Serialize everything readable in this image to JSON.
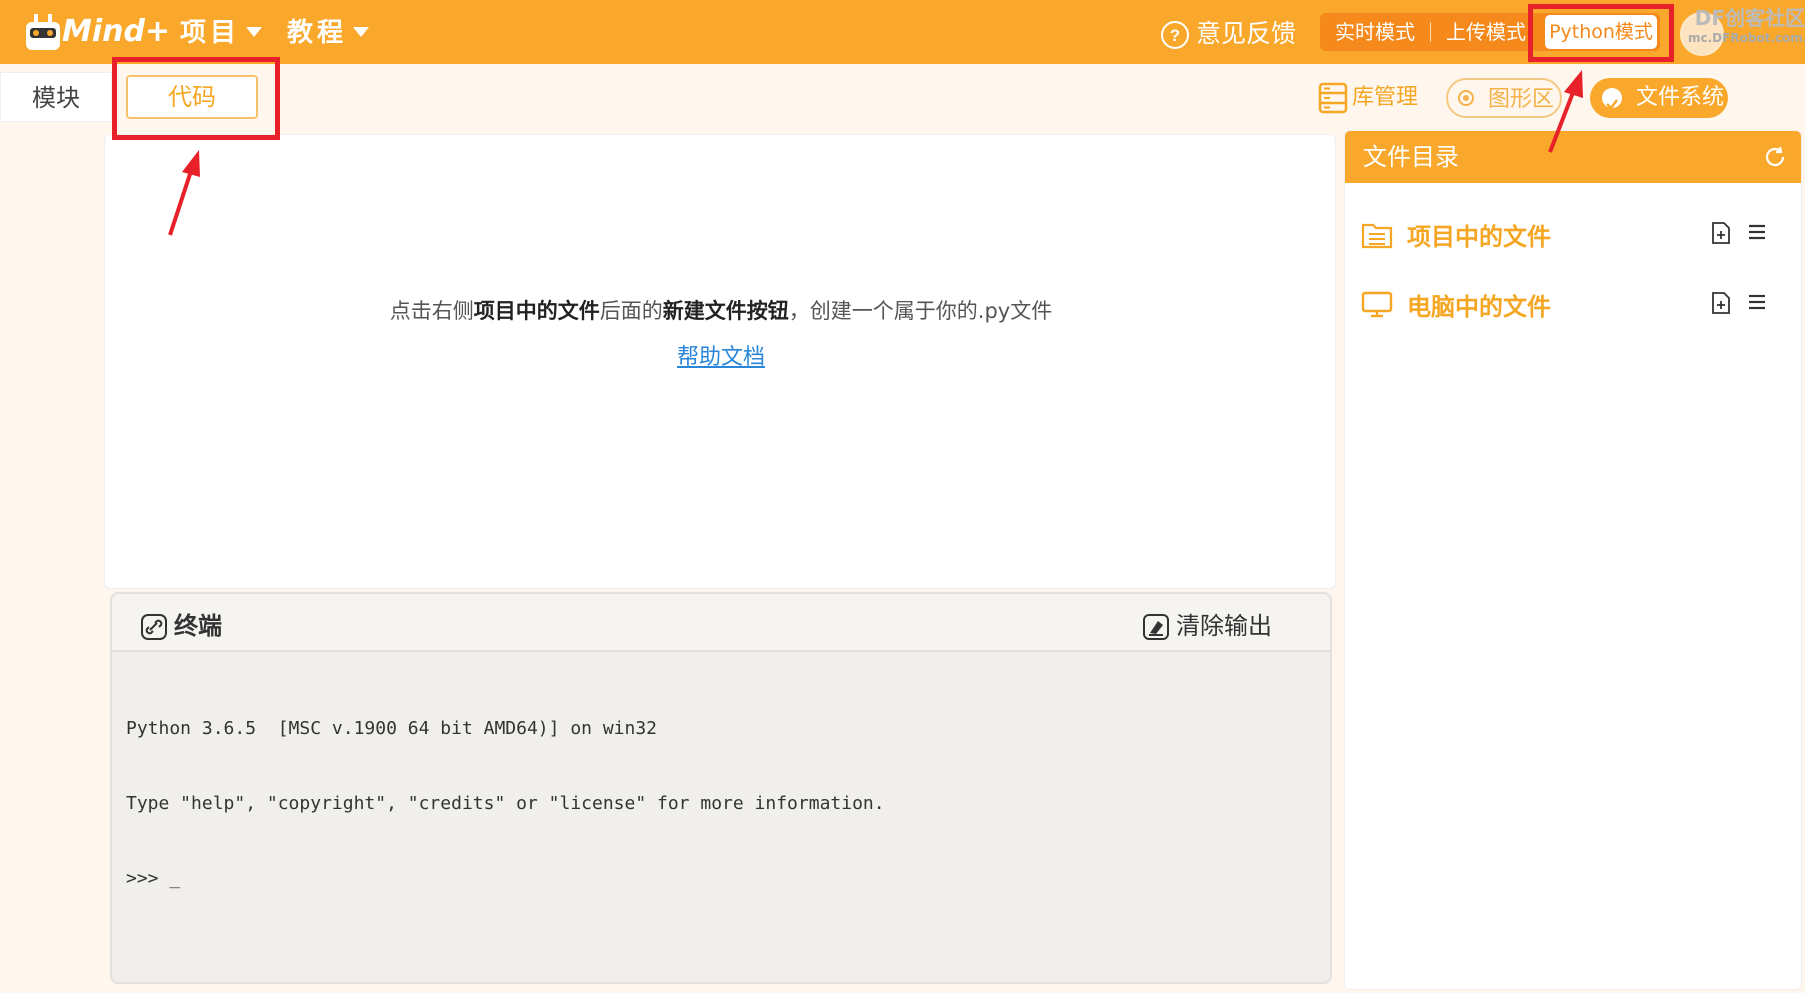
{
  "header": {
    "logo_text": "Mind+",
    "menu": [
      {
        "label": "项目"
      },
      {
        "label": "教程"
      }
    ],
    "feedback_label": "意见反馈",
    "modes": {
      "realtime": "实时模式",
      "upload": "上传模式",
      "python": "Python模式"
    },
    "watermark": {
      "line1": "DF创客社区",
      "line2": "mc.DFRobot.com.cn"
    }
  },
  "tabs": {
    "blocks": "模块",
    "code": "代码"
  },
  "toolbar": {
    "library": "库管理",
    "graph": "图形区",
    "filesystem": "文件系统"
  },
  "editor": {
    "hint_prefix": "点击右侧",
    "hint_bold1": "项目中的文件",
    "hint_mid": "后面的",
    "hint_bold2": "新建文件按钮",
    "hint_suffix": "，创建一个属于你的.py文件",
    "help_link": "帮助文档"
  },
  "terminal": {
    "title": "终端",
    "clear_label": "清除输出",
    "lines": [
      "Python 3.6.5  [MSC v.1900 64 bit AMD64)] on win32",
      "Type \"help\", \"copyright\", \"credits\" or \"license\" for more information.",
      ">>> _"
    ]
  },
  "file_panel": {
    "title": "文件目录",
    "items": [
      {
        "label": "项目中的文件"
      },
      {
        "label": "电脑中的文件"
      }
    ]
  },
  "colors": {
    "accent": "#f9a82c",
    "accent_dark": "#f5891b",
    "annotation": "#e8202a",
    "link": "#2a86d8"
  }
}
